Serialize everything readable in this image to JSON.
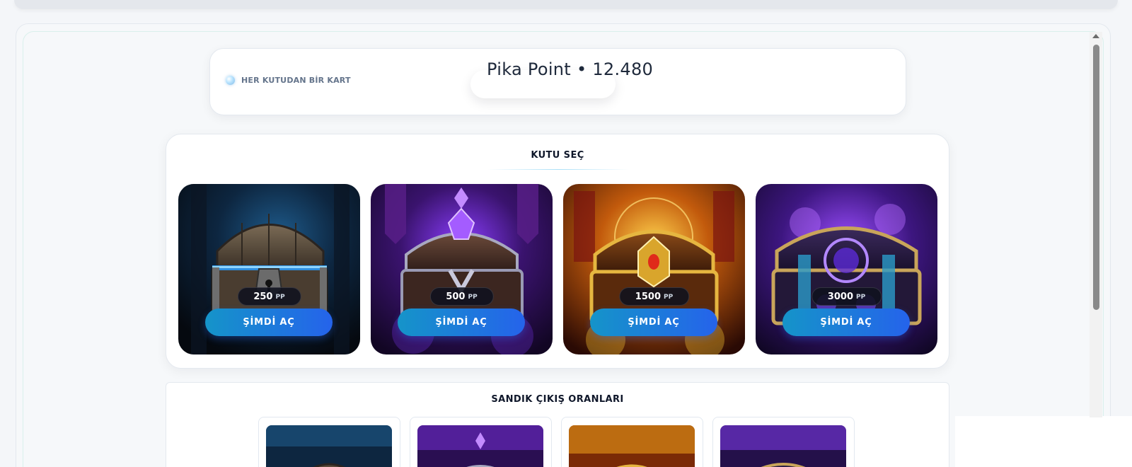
{
  "header": {
    "tagline": "HER KUTUDAN BİR KART",
    "points_text": "Pika Point  •  12.480"
  },
  "box_select": {
    "title": "KUTU SEÇ",
    "chests": [
      {
        "price": "250",
        "unit": "PP",
        "button": "ŞİMDİ AÇ",
        "theme": "wooden-blue",
        "icon": "wooden-chest-icon"
      },
      {
        "price": "500",
        "unit": "PP",
        "button": "ŞİMDİ AÇ",
        "theme": "purple-crystal",
        "icon": "crystal-chest-icon"
      },
      {
        "price": "1500",
        "unit": "PP",
        "button": "ŞİMDİ AÇ",
        "theme": "golden",
        "icon": "golden-chest-icon"
      },
      {
        "price": "3000",
        "unit": "PP",
        "button": "ŞİMDİ AÇ",
        "theme": "arcane-purple",
        "icon": "arcane-chest-icon"
      }
    ]
  },
  "odds": {
    "title": "SANDIK ÇIKIŞ ORANLARI"
  },
  "colors": {
    "accent_start": "#1594c9",
    "accent_end": "#2563eb",
    "text_dark": "#0f172a",
    "muted": "#64748b"
  }
}
